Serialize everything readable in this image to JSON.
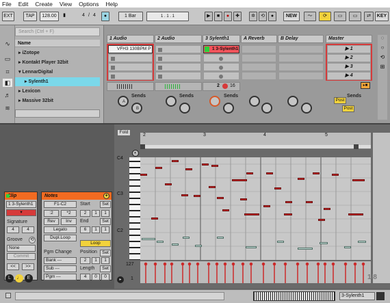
{
  "menu": [
    "File",
    "Edit",
    "Create",
    "View",
    "Options",
    "Help"
  ],
  "transport": {
    "ext": "EXT",
    "tap": "TAP",
    "tempo": "128.00",
    "sig_num": "4",
    "sig_den": "4",
    "quant": "1 Bar",
    "new": "NEW",
    "key": "KEY"
  },
  "browser": {
    "search_placeholder": "Search (Ctrl + F)",
    "header": "Name",
    "items": [
      {
        "label": "iZotope"
      },
      {
        "label": "Kontakt Player 32bit"
      },
      {
        "label": "LennarDigital"
      },
      {
        "label": "Sylenth1"
      },
      {
        "label": "Lexicon"
      },
      {
        "label": "Massive 32bit"
      }
    ]
  },
  "tracks": [
    {
      "name": "1 Audio"
    },
    {
      "name": "2 Audio"
    },
    {
      "name": "3 Sylenth1"
    },
    {
      "name": "A Reverb"
    },
    {
      "name": "B Delay"
    },
    {
      "name": "Master"
    }
  ],
  "clips": {
    "track1": "VFH3 130BPM P",
    "track3": "1 3-Sylenth1"
  },
  "scenes": [
    "1",
    "2",
    "3",
    "4"
  ],
  "mixer": {
    "sends": "Sends",
    "a": "A",
    "b": "B",
    "track3_num": "2",
    "track3_mon": "16",
    "post": "Post"
  },
  "fold": "Fold",
  "ruler": [
    "2",
    "3",
    "4",
    "5"
  ],
  "pitch_labels": [
    "C4",
    "C3",
    "C2"
  ],
  "velocity_max": "127",
  "velocity_min": "1",
  "zoom": "1/8",
  "clip_panel": {
    "title": "Clip",
    "name": "1 3-Sylenth1",
    "signature": "Signature",
    "sig_num": "4",
    "sig_den": "4",
    "groove": "Groove",
    "groove_val": "None",
    "commit": "Commit"
  },
  "notes_panel": {
    "title": "Notes",
    "range": "F1-C2",
    "div2": ":2",
    "mul2": "*2",
    "rev": "Rev",
    "inv": "Inv",
    "legato": "Legato",
    "dupl": "Dupl.Loop",
    "start": "Start",
    "end": "End",
    "loop": "Loop",
    "position": "Position",
    "length": "Length",
    "pgm": "Pgm Change",
    "bank": "Bank ---",
    "sub": "Sub ---",
    "pgm_val": "Pgm ---",
    "set": "Set",
    "start_vals": [
      "2",
      "1",
      "1"
    ],
    "end_vals": [
      "6",
      "1",
      "1"
    ],
    "pos_vals": [
      "2",
      "1",
      "1"
    ],
    "len_vals": [
      "4",
      "0",
      "0"
    ]
  },
  "status": {
    "track": "3-Sylenth1"
  }
}
